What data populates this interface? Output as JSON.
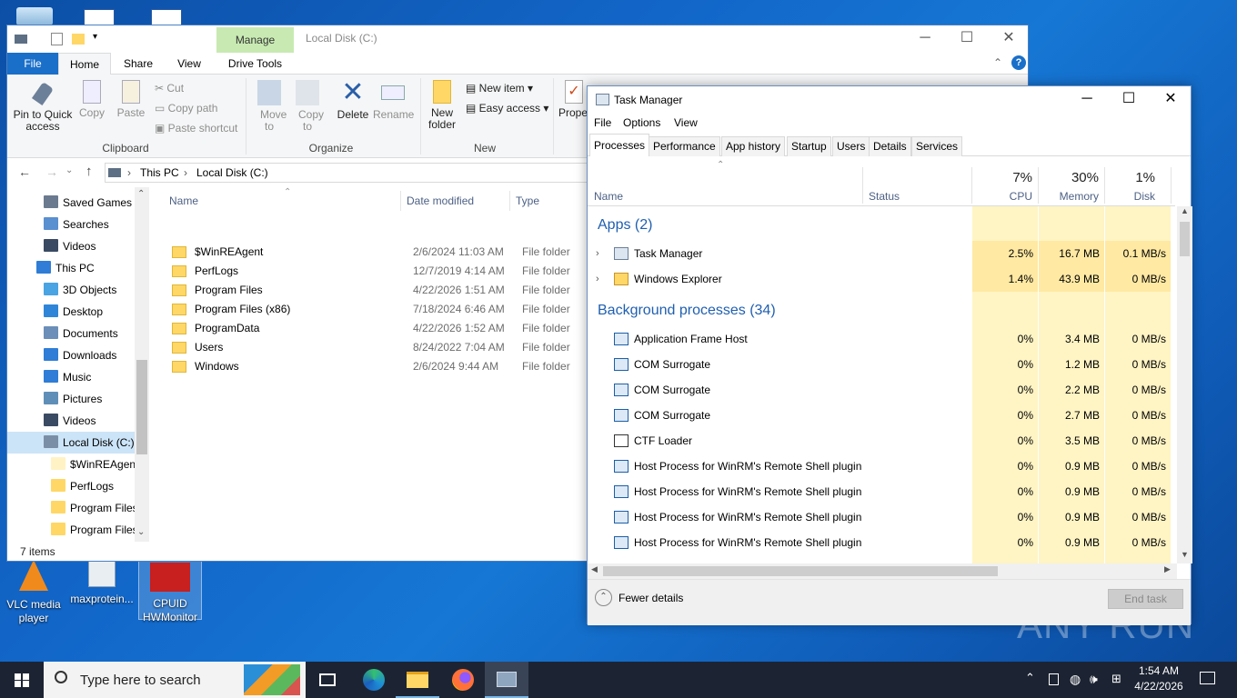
{
  "desktop": {
    "icons": [
      {
        "label": "VLC media player"
      },
      {
        "label": "maxprotein..."
      },
      {
        "label": "CPUID HWMonitor"
      }
    ],
    "watermark": "ANY RUN"
  },
  "explorer": {
    "title": "Local Disk (C:)",
    "contextual_tab_group": "Manage",
    "tabs": [
      "File",
      "Home",
      "Share",
      "View",
      "Drive Tools"
    ],
    "ribbon": {
      "pin_label": "Pin to Quick access",
      "copy_label": "Copy",
      "paste_label": "Paste",
      "cut_label": "Cut",
      "copy_path_label": "Copy path",
      "paste_shortcut_label": "Paste shortcut",
      "clipboard_group": "Clipboard",
      "move_to_label": "Move to",
      "copy_to_label": "Copy to",
      "delete_label": "Delete",
      "rename_label": "Rename",
      "organize_group": "Organize",
      "new_folder_label": "New folder",
      "new_item_label": "New item",
      "easy_access_label": "Easy access",
      "new_group": "New",
      "properties_label": "Propert"
    },
    "breadcrumb": [
      "This PC",
      "Local Disk (C:)"
    ],
    "nav": [
      {
        "label": "Saved Games",
        "indent": 1,
        "color": "#6b7a8f"
      },
      {
        "label": "Searches",
        "indent": 1,
        "color": "#5a8fd0"
      },
      {
        "label": "Videos",
        "indent": 1,
        "color": "#3b4a63"
      },
      {
        "label": "This PC",
        "indent": 0,
        "color": "#2f7dd6"
      },
      {
        "label": "3D Objects",
        "indent": 1,
        "color": "#4aa3e3"
      },
      {
        "label": "Desktop",
        "indent": 1,
        "color": "#2f86d8"
      },
      {
        "label": "Documents",
        "indent": 1,
        "color": "#6b8fb8"
      },
      {
        "label": "Downloads",
        "indent": 1,
        "color": "#2f7dd6"
      },
      {
        "label": "Music",
        "indent": 1,
        "color": "#2f7dd6"
      },
      {
        "label": "Pictures",
        "indent": 1,
        "color": "#5f8fb8"
      },
      {
        "label": "Videos",
        "indent": 1,
        "color": "#3b4a63"
      },
      {
        "label": "Local Disk (C:)",
        "indent": 1,
        "color": "#7a8fa6",
        "selected": true
      },
      {
        "label": "$WinREAgent",
        "indent": 2,
        "color": "#fff2c4"
      },
      {
        "label": "PerfLogs",
        "indent": 2,
        "color": "#ffd767"
      },
      {
        "label": "Program Files",
        "indent": 2,
        "color": "#ffd767"
      },
      {
        "label": "Program Files",
        "indent": 2,
        "color": "#ffd767"
      }
    ],
    "columns": {
      "name": "Name",
      "date": "Date modified",
      "type": "Type"
    },
    "files": [
      {
        "name": "$WinREAgent",
        "date": "2/6/2024 11:03 AM",
        "type": "File folder"
      },
      {
        "name": "PerfLogs",
        "date": "12/7/2019 4:14 AM",
        "type": "File folder"
      },
      {
        "name": "Program Files",
        "date": "4/22/2026 1:51 AM",
        "type": "File folder"
      },
      {
        "name": "Program Files (x86)",
        "date": "7/18/2024 6:46 AM",
        "type": "File folder"
      },
      {
        "name": "ProgramData",
        "date": "4/22/2026 1:52 AM",
        "type": "File folder"
      },
      {
        "name": "Users",
        "date": "8/24/2022 7:04 AM",
        "type": "File folder"
      },
      {
        "name": "Windows",
        "date": "2/6/2024 9:44 AM",
        "type": "File folder"
      }
    ],
    "status": "7 items"
  },
  "taskmgr": {
    "title": "Task Manager",
    "menu": [
      "File",
      "Options",
      "View"
    ],
    "tabs": [
      "Processes",
      "Performance",
      "App history",
      "Startup",
      "Users",
      "Details",
      "Services"
    ],
    "columns": {
      "name": "Name",
      "status": "Status",
      "cpu_pct": "7%",
      "cpu": "CPU",
      "mem_pct": "30%",
      "mem": "Memory",
      "disk_pct": "1%",
      "disk": "Disk"
    },
    "apps_group": "Apps (2)",
    "apps": [
      {
        "name": "Task Manager",
        "cpu": "2.5%",
        "mem": "16.7 MB",
        "disk": "0.1 MB/s"
      },
      {
        "name": "Windows Explorer",
        "cpu": "1.4%",
        "mem": "43.9 MB",
        "disk": "0 MB/s"
      }
    ],
    "bg_group": "Background processes (34)",
    "bg": [
      {
        "name": "Application Frame Host",
        "cpu": "0%",
        "mem": "3.4 MB",
        "disk": "0 MB/s"
      },
      {
        "name": "COM Surrogate",
        "cpu": "0%",
        "mem": "1.2 MB",
        "disk": "0 MB/s"
      },
      {
        "name": "COM Surrogate",
        "cpu": "0%",
        "mem": "2.2 MB",
        "disk": "0 MB/s"
      },
      {
        "name": "COM Surrogate",
        "cpu": "0%",
        "mem": "2.7 MB",
        "disk": "0 MB/s"
      },
      {
        "name": "CTF Loader",
        "cpu": "0%",
        "mem": "3.5 MB",
        "disk": "0 MB/s"
      },
      {
        "name": "Host Process for WinRM's Remote Shell plugin",
        "cpu": "0%",
        "mem": "0.9 MB",
        "disk": "0 MB/s"
      },
      {
        "name": "Host Process for WinRM's Remote Shell plugin",
        "cpu": "0%",
        "mem": "0.9 MB",
        "disk": "0 MB/s"
      },
      {
        "name": "Host Process for WinRM's Remote Shell plugin",
        "cpu": "0%",
        "mem": "0.9 MB",
        "disk": "0 MB/s"
      },
      {
        "name": "Host Process for WinRM's Remote Shell plugin",
        "cpu": "0%",
        "mem": "0.9 MB",
        "disk": "0 MB/s"
      }
    ],
    "fewer_details": "Fewer details",
    "end_task": "End task"
  },
  "taskbar": {
    "search_placeholder": "Type here to search",
    "time": "1:54 AM",
    "date": "4/22/2026"
  }
}
